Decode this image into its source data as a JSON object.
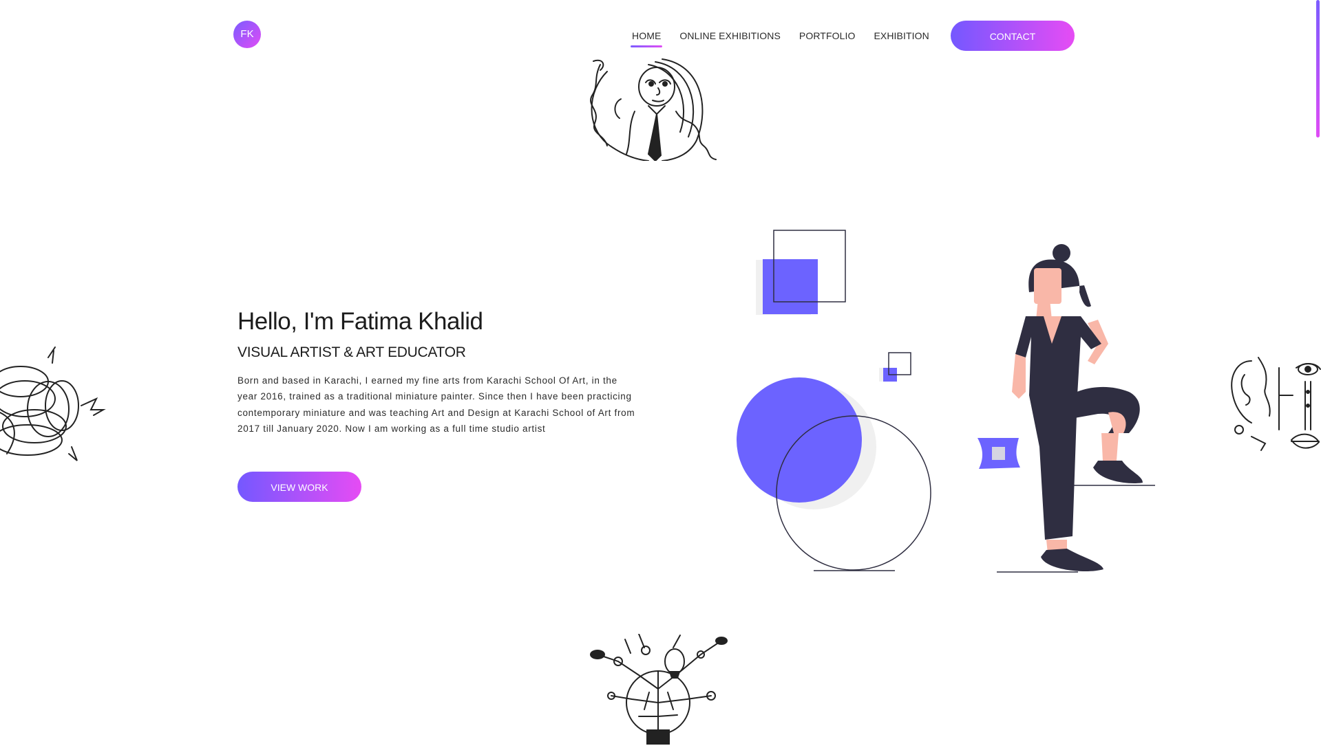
{
  "header": {
    "logo_initials": "FK",
    "nav": [
      {
        "label": "HOME",
        "active": true
      },
      {
        "label": "ONLINE EXHIBITIONS",
        "active": false
      },
      {
        "label": "PORTFOLIO",
        "active": false
      },
      {
        "label": "EXHIBITION",
        "active": false
      }
    ],
    "contact_label": "CONTACT"
  },
  "hero": {
    "title": "Hello, I'm Fatima Khalid",
    "subtitle": "VISUAL ARTIST & ART EDUCATOR",
    "bio": "Born and based in Karachi, I earned my fine arts from Karachi School Of Art, in the year 2016, trained as a traditional miniature painter. Since then I have been practicing contemporary miniature and was teaching Art and Design at Karachi School of Art from 2017 till January 2020. Now I am working as a full time studio artist",
    "cta_label": "VIEW WORK"
  },
  "colors": {
    "accent_start": "#7458ff",
    "accent_end": "#e64cf4",
    "shape_purple": "#6c63ff",
    "figure_dark": "#2f2e41",
    "skin": "#f9b7a8"
  },
  "icons": [
    "line-art-portrait-sketch",
    "line-art-knot-sketch",
    "line-art-faces-sketch",
    "line-art-lightbulb-sketch"
  ]
}
